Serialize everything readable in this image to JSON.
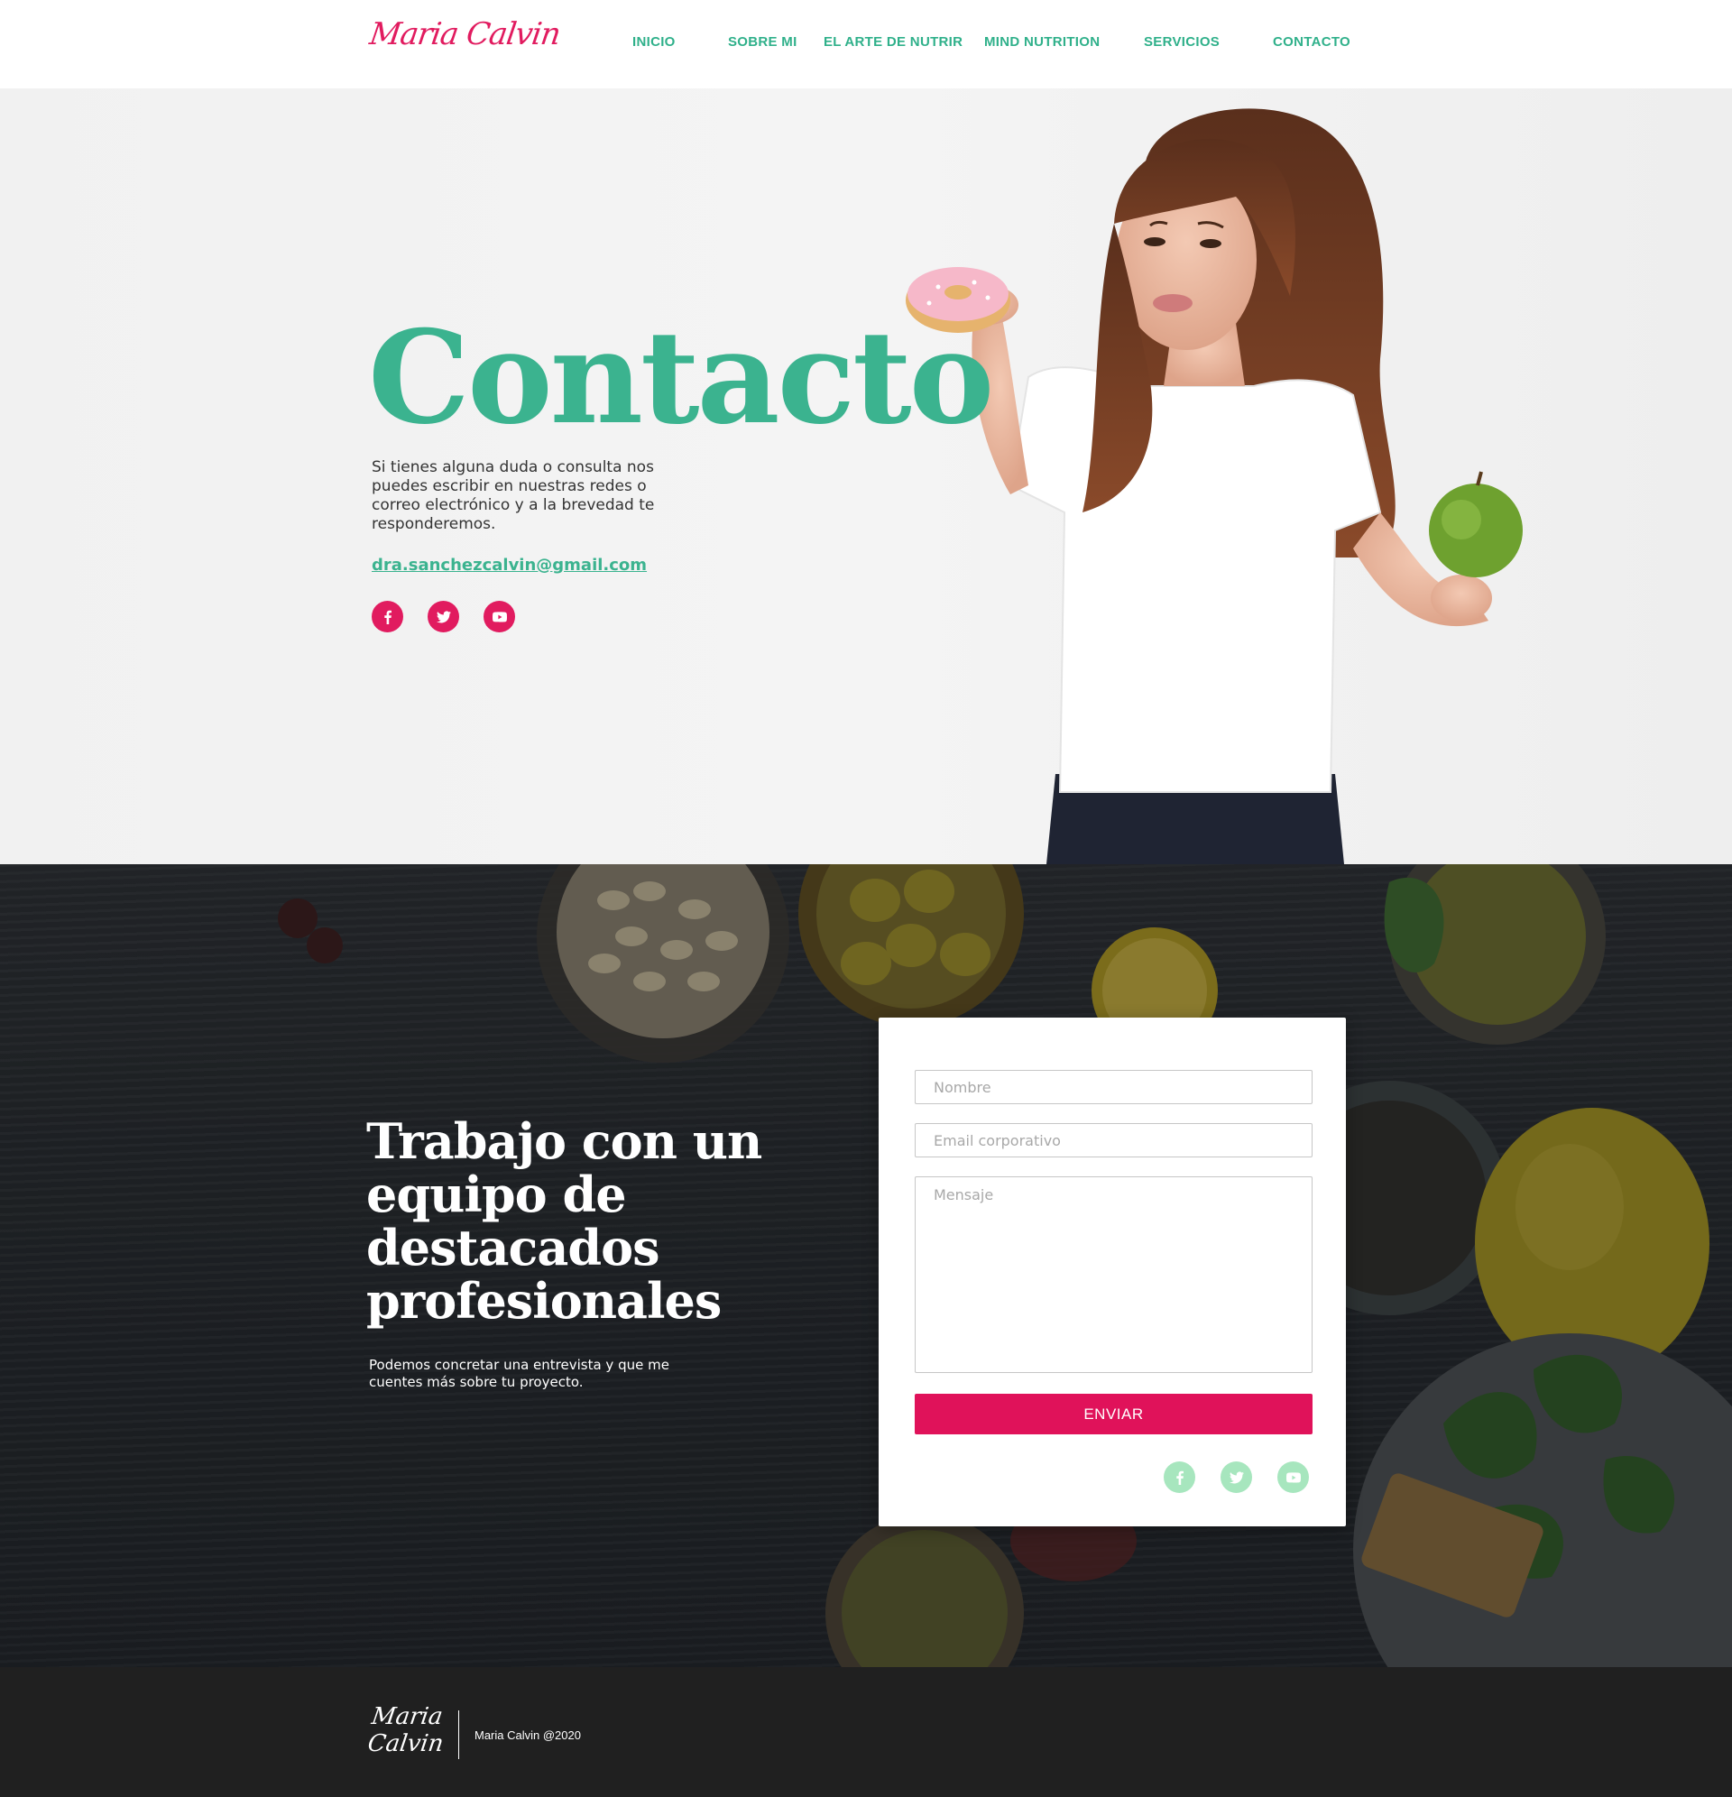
{
  "header": {
    "logo": "Maria Calvin",
    "nav": [
      {
        "label": "INICIO"
      },
      {
        "label": "SOBRE MI"
      },
      {
        "label": "EL ARTE DE NUTRIR"
      },
      {
        "label": "MIND NUTRITION"
      },
      {
        "label": "SERVICIOS"
      },
      {
        "label": "CONTACTO"
      }
    ]
  },
  "hero": {
    "title": "Contacto",
    "text": "Si tienes alguna duda o consulta nos puedes escribir en nuestras redes o correo electrónico y a la brevedad te responderemos.",
    "email": "dra.sanchezcalvin@gmail.com",
    "social": [
      "facebook-icon",
      "twitter-icon",
      "youtube-icon"
    ]
  },
  "contact": {
    "title": "Trabajo con un equipo de destacados profesionales",
    "text": "Podemos concretar una entrevista y que me cuentes más sobre tu proyecto.",
    "form": {
      "name_placeholder": "Nombre",
      "email_placeholder": "Email corporativo",
      "message_placeholder": "Mensaje",
      "submit_label": "ENVIAR"
    },
    "social": [
      "facebook-icon",
      "twitter-icon",
      "youtube-icon"
    ]
  },
  "footer": {
    "logo": "Maria Calvin",
    "copyright": "Maria Calvin @2020"
  },
  "colors": {
    "accent_green": "#3bb38f",
    "accent_pink": "#e11b5f",
    "mint": "#a7e6be",
    "dark": "#202020"
  }
}
